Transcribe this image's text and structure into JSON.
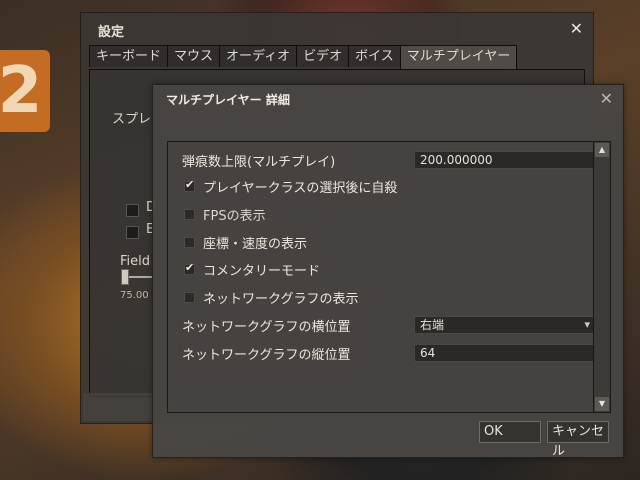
{
  "settings_window": {
    "title": "設定",
    "close_icon": "✕",
    "tabs": [
      {
        "label": "キーボード"
      },
      {
        "label": "マウス"
      },
      {
        "label": "オーディオ"
      },
      {
        "label": "ビデオ"
      },
      {
        "label": "ボイス"
      },
      {
        "label": "マルチプレイヤー"
      }
    ],
    "active_tab": "マルチプレイヤー",
    "panel": {
      "partial_label": "スプレ",
      "checkbox_1_partial": "D",
      "checkbox_2_partial": "E",
      "field_label_partial": "Field",
      "slider_value": "75.00"
    }
  },
  "advanced_dialog": {
    "title": "マルチプレイヤー 詳細",
    "close_icon": "✕",
    "decal_limit": {
      "label": "弾痕数上限(マルチプレイ)",
      "value": "200.000000"
    },
    "checkboxes": [
      {
        "label": "プレイヤークラスの選択後に自殺",
        "checked": true
      },
      {
        "label": "FPSの表示",
        "checked": false
      },
      {
        "label": "座標・速度の表示",
        "checked": false
      },
      {
        "label": "コメンタリーモード",
        "checked": true
      },
      {
        "label": "ネットワークグラフの表示",
        "checked": false
      }
    ],
    "graph_x_position": {
      "label": "ネットワークグラフの横位置",
      "value": "右端"
    },
    "graph_y_position": {
      "label": "ネットワークグラフの縦位置",
      "value": "64"
    },
    "ok_label": "OK",
    "cancel_label": "キャンセル"
  },
  "colors": {
    "dialog_bg": "#484542",
    "field_bg": "#2a2927",
    "text": "#ece6da"
  }
}
